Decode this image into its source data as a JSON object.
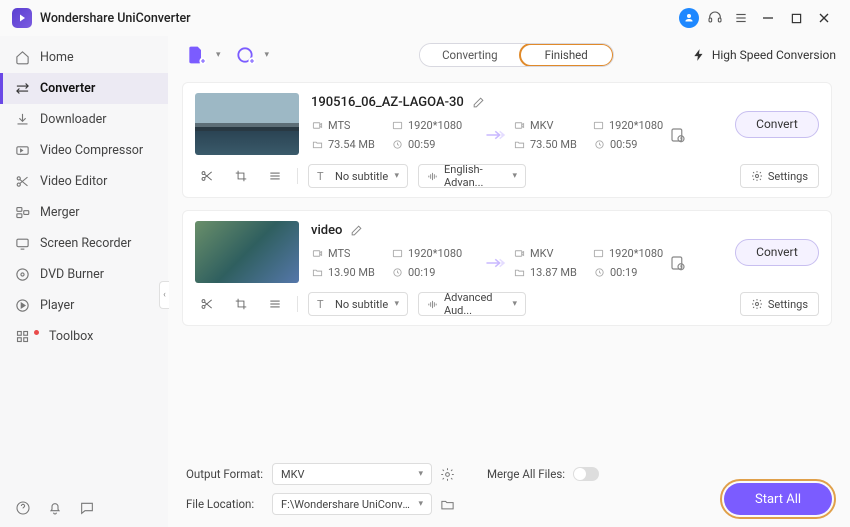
{
  "app": {
    "title": "Wondershare UniConverter"
  },
  "sidebar": {
    "items": [
      {
        "label": "Home"
      },
      {
        "label": "Converter"
      },
      {
        "label": "Downloader"
      },
      {
        "label": "Video Compressor"
      },
      {
        "label": "Video Editor"
      },
      {
        "label": "Merger"
      },
      {
        "label": "Screen Recorder"
      },
      {
        "label": "DVD Burner"
      },
      {
        "label": "Player"
      },
      {
        "label": "Toolbox"
      }
    ]
  },
  "tabs": {
    "converting": "Converting",
    "finished": "Finished"
  },
  "toolbar": {
    "high_speed": "High Speed Conversion"
  },
  "files": [
    {
      "name": "190516_06_AZ-LAGOA-30",
      "src": {
        "format": "MTS",
        "resolution": "1920*1080",
        "size": "73.54 MB",
        "duration": "00:59"
      },
      "dst": {
        "format": "MKV",
        "resolution": "1920*1080",
        "size": "73.50 MB",
        "duration": "00:59"
      },
      "subtitle": "No subtitle",
      "audio": "English-Advan...",
      "settings": "Settings",
      "convert": "Convert"
    },
    {
      "name": "video",
      "src": {
        "format": "MTS",
        "resolution": "1920*1080",
        "size": "13.90 MB",
        "duration": "00:19"
      },
      "dst": {
        "format": "MKV",
        "resolution": "1920*1080",
        "size": "13.87 MB",
        "duration": "00:19"
      },
      "subtitle": "No subtitle",
      "audio": "Advanced Aud...",
      "settings": "Settings",
      "convert": "Convert"
    }
  ],
  "footer": {
    "output_format_label": "Output Format:",
    "output_format_value": "MKV",
    "file_location_label": "File Location:",
    "file_location_value": "F:\\Wondershare UniConverter",
    "merge_label": "Merge All Files:",
    "start_all": "Start All"
  }
}
